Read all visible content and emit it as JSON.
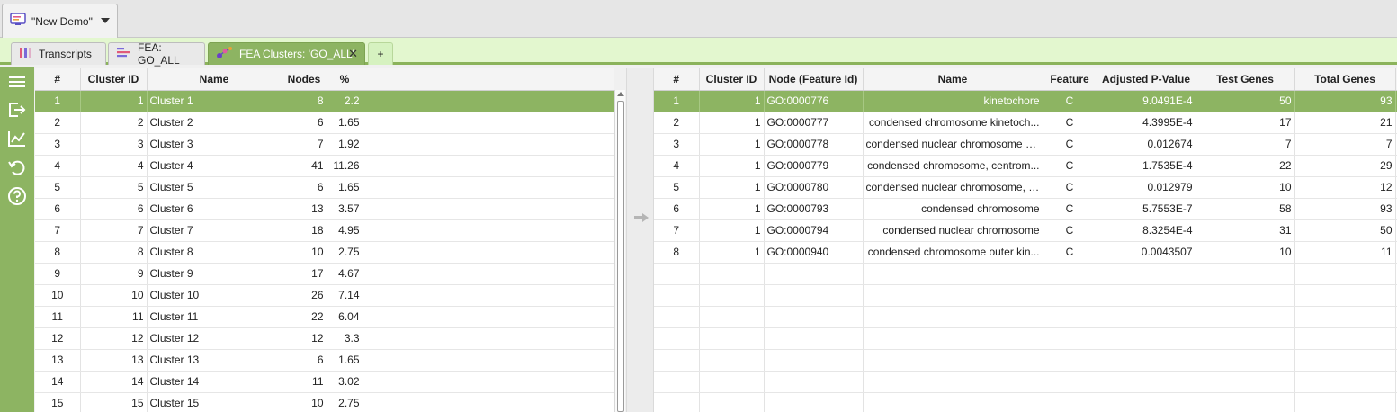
{
  "project": {
    "title": "\"New Demo\""
  },
  "tabs": [
    {
      "label": "Transcripts"
    },
    {
      "label": "FEA: GO_ALL"
    },
    {
      "label": "FEA Clusters: 'GO_ALL'"
    },
    {
      "label": "+"
    }
  ],
  "tools": [
    "menu-icon",
    "export-icon",
    "chart-icon",
    "reset-icon",
    "help-icon"
  ],
  "colors": {
    "accent": "#8db462",
    "tabbar_bg": "#e3f7cf"
  },
  "clusters": {
    "headers": [
      "#",
      "Cluster ID",
      "Name",
      "Nodes",
      "%"
    ],
    "rows": [
      [
        "1",
        "1",
        "Cluster 1",
        "8",
        "2.2"
      ],
      [
        "2",
        "2",
        "Cluster 2",
        "6",
        "1.65"
      ],
      [
        "3",
        "3",
        "Cluster 3",
        "7",
        "1.92"
      ],
      [
        "4",
        "4",
        "Cluster 4",
        "41",
        "11.26"
      ],
      [
        "5",
        "5",
        "Cluster 5",
        "6",
        "1.65"
      ],
      [
        "6",
        "6",
        "Cluster 6",
        "13",
        "3.57"
      ],
      [
        "7",
        "7",
        "Cluster 7",
        "18",
        "4.95"
      ],
      [
        "8",
        "8",
        "Cluster 8",
        "10",
        "2.75"
      ],
      [
        "9",
        "9",
        "Cluster 9",
        "17",
        "4.67"
      ],
      [
        "10",
        "10",
        "Cluster 10",
        "26",
        "7.14"
      ],
      [
        "11",
        "11",
        "Cluster 11",
        "22",
        "6.04"
      ],
      [
        "12",
        "12",
        "Cluster 12",
        "12",
        "3.3"
      ],
      [
        "13",
        "13",
        "Cluster 13",
        "6",
        "1.65"
      ],
      [
        "14",
        "14",
        "Cluster 14",
        "11",
        "3.02"
      ],
      [
        "15",
        "15",
        "Cluster 15",
        "10",
        "2.75"
      ]
    ],
    "selected_row": 0
  },
  "features": {
    "headers": [
      "#",
      "Cluster ID",
      "Node (Feature Id)",
      "Name",
      "Feature",
      "Adjusted P-Value",
      "Test Genes",
      "Total Genes"
    ],
    "rows": [
      [
        "1",
        "1",
        "GO:0000776",
        "kinetochore",
        "C",
        "9.0491E-4",
        "50",
        "93"
      ],
      [
        "2",
        "1",
        "GO:0000777",
        "condensed chromosome kinetoch...",
        "C",
        "4.3995E-4",
        "17",
        "21"
      ],
      [
        "3",
        "1",
        "GO:0000778",
        "condensed nuclear chromosome k...",
        "C",
        "0.012674",
        "7",
        "7"
      ],
      [
        "4",
        "1",
        "GO:0000779",
        "condensed chromosome, centrom...",
        "C",
        "1.7535E-4",
        "22",
        "29"
      ],
      [
        "5",
        "1",
        "GO:0000780",
        "condensed nuclear chromosome, c...",
        "C",
        "0.012979",
        "10",
        "12"
      ],
      [
        "6",
        "1",
        "GO:0000793",
        "condensed chromosome",
        "C",
        "5.7553E-7",
        "58",
        "93"
      ],
      [
        "7",
        "1",
        "GO:0000794",
        "condensed nuclear chromosome",
        "C",
        "8.3254E-4",
        "31",
        "50"
      ],
      [
        "8",
        "1",
        "GO:0000940",
        "condensed chromosome outer kin...",
        "C",
        "0.0043507",
        "10",
        "11"
      ]
    ],
    "empty_rows": 7,
    "selected_row": 0
  }
}
